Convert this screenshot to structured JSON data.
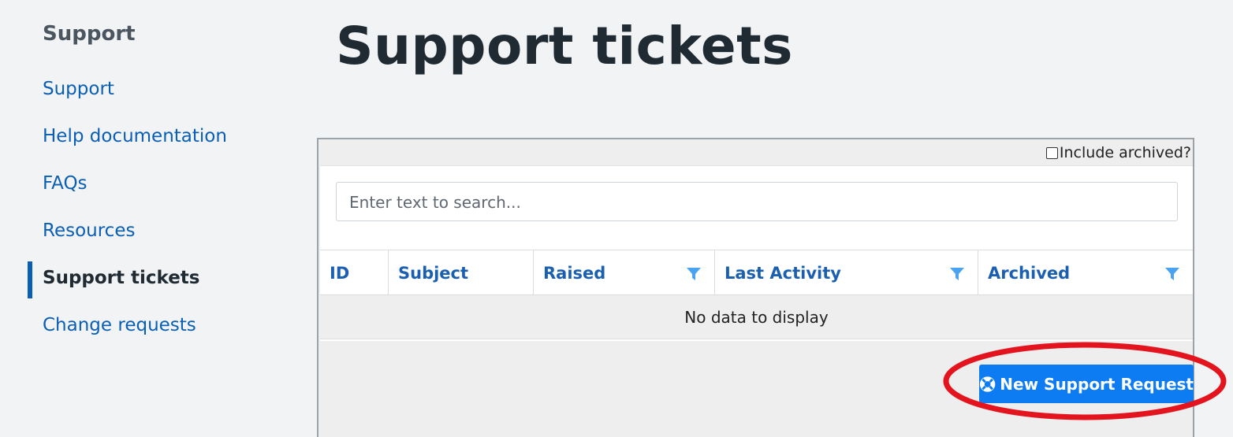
{
  "sidebar": {
    "title": "Support",
    "items": [
      {
        "label": "Support",
        "active": false
      },
      {
        "label": "Help documentation",
        "active": false
      },
      {
        "label": "FAQs",
        "active": false
      },
      {
        "label": "Resources",
        "active": false
      },
      {
        "label": "Support tickets",
        "active": true
      },
      {
        "label": "Change requests",
        "active": false
      }
    ]
  },
  "main": {
    "title": "Support tickets",
    "include_archived_label": "Include archived?",
    "include_archived_checked": false,
    "search": {
      "placeholder": "Enter text to search..."
    },
    "columns": [
      {
        "label": "ID",
        "filterable": false
      },
      {
        "label": "Subject",
        "filterable": false
      },
      {
        "label": "Raised",
        "filterable": true
      },
      {
        "label": "Last Activity",
        "filterable": true
      },
      {
        "label": "Archived",
        "filterable": true
      }
    ],
    "empty_message": "No data to display",
    "new_button_label": "New Support Request"
  },
  "colors": {
    "link": "#0a5fb4",
    "button": "#0d7cf2",
    "filter_icon": "#4aa3f0",
    "highlight": "#e3141e"
  },
  "icons": {
    "filter": "filter-icon",
    "new_request": "lifebuoy-icon"
  }
}
